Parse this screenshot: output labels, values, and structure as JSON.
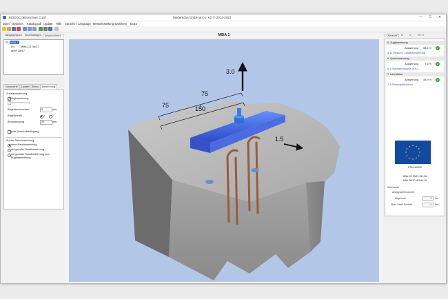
{
  "window": {
    "app_title": "MODOCOBSrechner 3.107",
    "company": "Modersohn GmbH & Co. KG  © 2014-2022",
    "minimize": "—",
    "maximize": "☐",
    "close": "✕"
  },
  "menu": [
    "Datei",
    "Optionen",
    "Katalog.pdf",
    "Update",
    "Hilfe",
    "Sprache / Language",
    "Messeinstellung speichern",
    "Extra"
  ],
  "left_panel": {
    "tabs": [
      "Hängegerippen",
      "Einzelsträngen",
      "Ankerschienen"
    ],
    "tree": {
      "root": "MBA 1",
      "child1_code": "D4",
      "child1_label": "MBA-CE 38/17",
      "child2_label": "MHK 38/17"
    },
    "sub_tabs": [
      "Geometrie",
      "Lasten",
      "Beton",
      "Bewehrung"
    ],
    "zusatz_title": "Zusatzbewehrung",
    "zugbewehrung": "Zugbewehrung",
    "querbewehrung": "Querbewehrung",
    "buegeldurchmesser_label": "Bügeldurchmesser",
    "buegeldurchmesser_value": "8",
    "buegelanzahl_label": "Bügelanzahl",
    "buegelanzahl_opt1": "1",
    "buegelanzahl_opt2": "2",
    "betondeckung_label": "Betondeckung",
    "betondeckung_value": "25",
    "unit_mm": "mm",
    "verbund_label": "gute Verbundbedingung",
    "rand_title": "Art der Randbewehrung",
    "rand_opt1": "ohne Randbewehrung",
    "rand_opt2": "mit gerader Randbewehrung",
    "rand_opt3": "mit gerader Randbewehrung und Bügelbewehrung"
  },
  "viewport": {
    "title": "MBA 1",
    "dims": [
      "75",
      "75",
      "150",
      "3.0",
      "1.5"
    ]
  },
  "right_panel": {
    "tabs": [
      "Übersicht",
      "N",
      "V",
      "N + V"
    ],
    "sections": [
      {
        "title": "5. Zugbewehrung",
        "label": "Auswertung",
        "value": "65.4 %",
        "link": "5.11 Verbund- Zusatzbewehrung"
      },
      {
        "title": "6. Querbewehrung",
        "label": "Auswertung",
        "value": "9.6 %",
        "link": "6.1 Spezialschraube (s.H.)"
      },
      {
        "title": "7. Interaktion",
        "label": "Auswertung",
        "value": "49.9 %",
        "link": "7.4 Betonkantenbruch"
      }
    ],
    "check_icon": "✓",
    "eta_id": "ETA-13/0209",
    "product_line1": "MBA-CE 38/17-150-D4",
    "product_line2": "MHK 38/17 M16 ft4.15",
    "kennwerte_title": "Kennwerte",
    "anzug_title": "Anzugsdrehmoment",
    "allgemein_label": "Allgemein",
    "allgemein_value": "15",
    "stahl_label": "Stahl-Stahl-Kontakt",
    "stahl_value": "40",
    "unit_nm": "Nm"
  },
  "colors": {
    "viewport_bg": "#b2c6e8",
    "concrete": "#a5a5a5",
    "anchor_blue": "#2f5ee8",
    "rebar": "#9a5a3c",
    "ok_green": "#3cae3c",
    "link_blue": "#2a55c8",
    "eu_blue": "#114aa0"
  }
}
